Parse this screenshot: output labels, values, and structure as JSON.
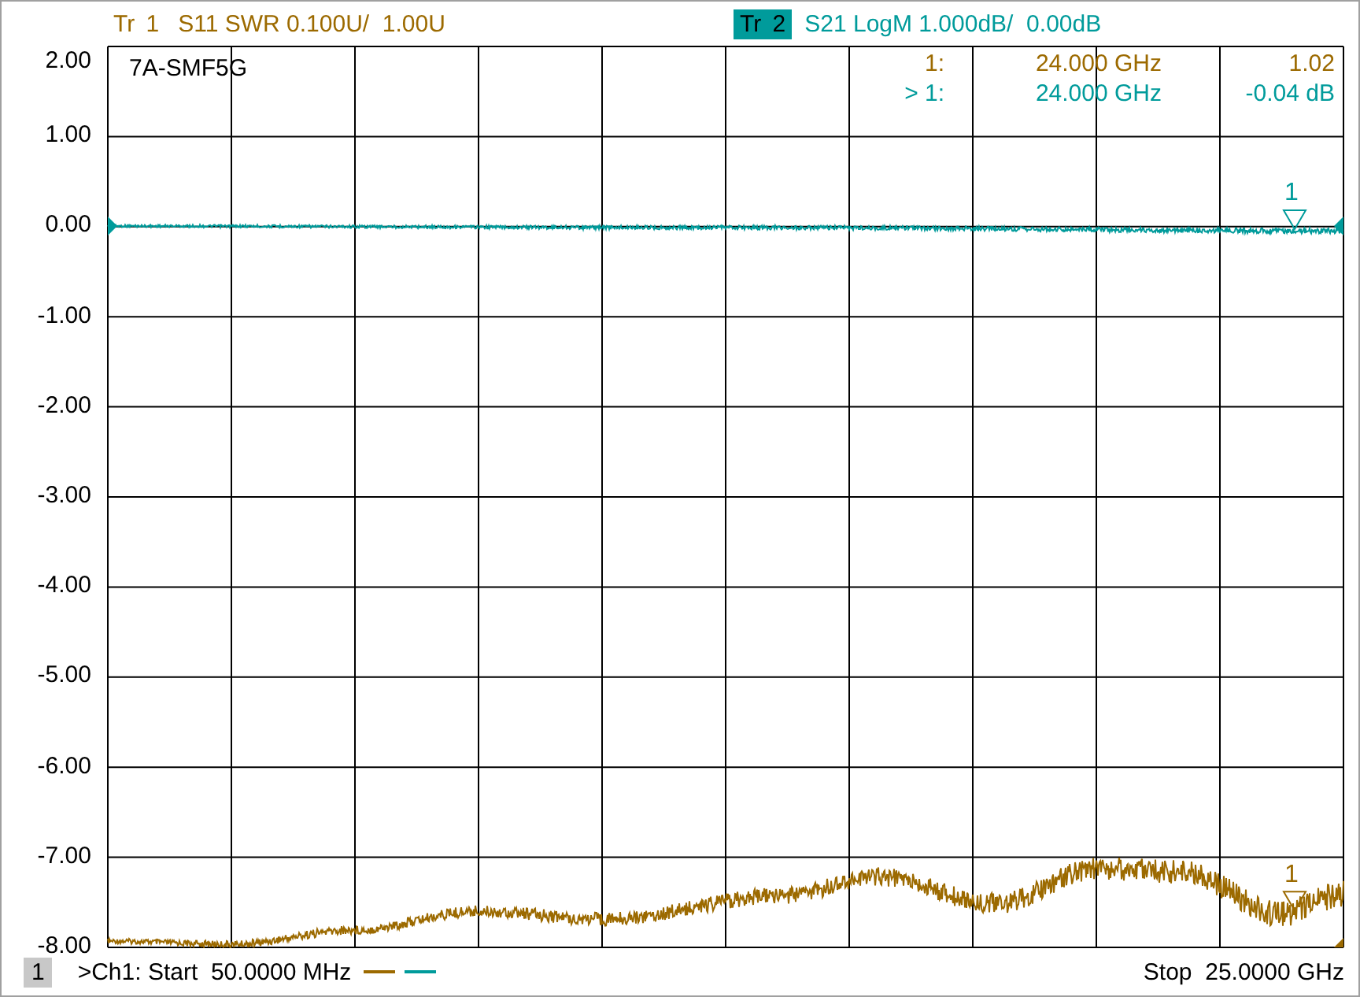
{
  "traces": [
    {
      "label": "Tr 1",
      "measurement": "S11 SWR 0.100U/  1.00U",
      "color": "#9c6a00",
      "selected": false,
      "marker": {
        "label": "1"
      }
    },
    {
      "label": "Tr 2",
      "measurement": "S21 LogM 1.000dB/  0.00dB",
      "color": "#009b9b",
      "selected": true,
      "marker": {
        "label": "1"
      }
    }
  ],
  "y_axis_labels": [
    "2.00",
    "1.00",
    "0.00",
    "-1.00",
    "-2.00",
    "-3.00",
    "-4.00",
    "-5.00",
    "-6.00",
    "-7.00",
    "-8.00"
  ],
  "plot_title": "7A-SMF5G",
  "marker_readouts": [
    {
      "label": "1:",
      "frequency": "24.000 GHz",
      "value": "1.02",
      "color": "#9c6a00"
    },
    {
      "label": "> 1:",
      "frequency": "24.000 GHz",
      "value": "-0.04 dB",
      "color": "#009b9b"
    }
  ],
  "footer": {
    "channel": "1",
    "start": ">Ch1: Start  50.0000 MHz",
    "stop": "Stop  25.0000 GHz"
  }
}
